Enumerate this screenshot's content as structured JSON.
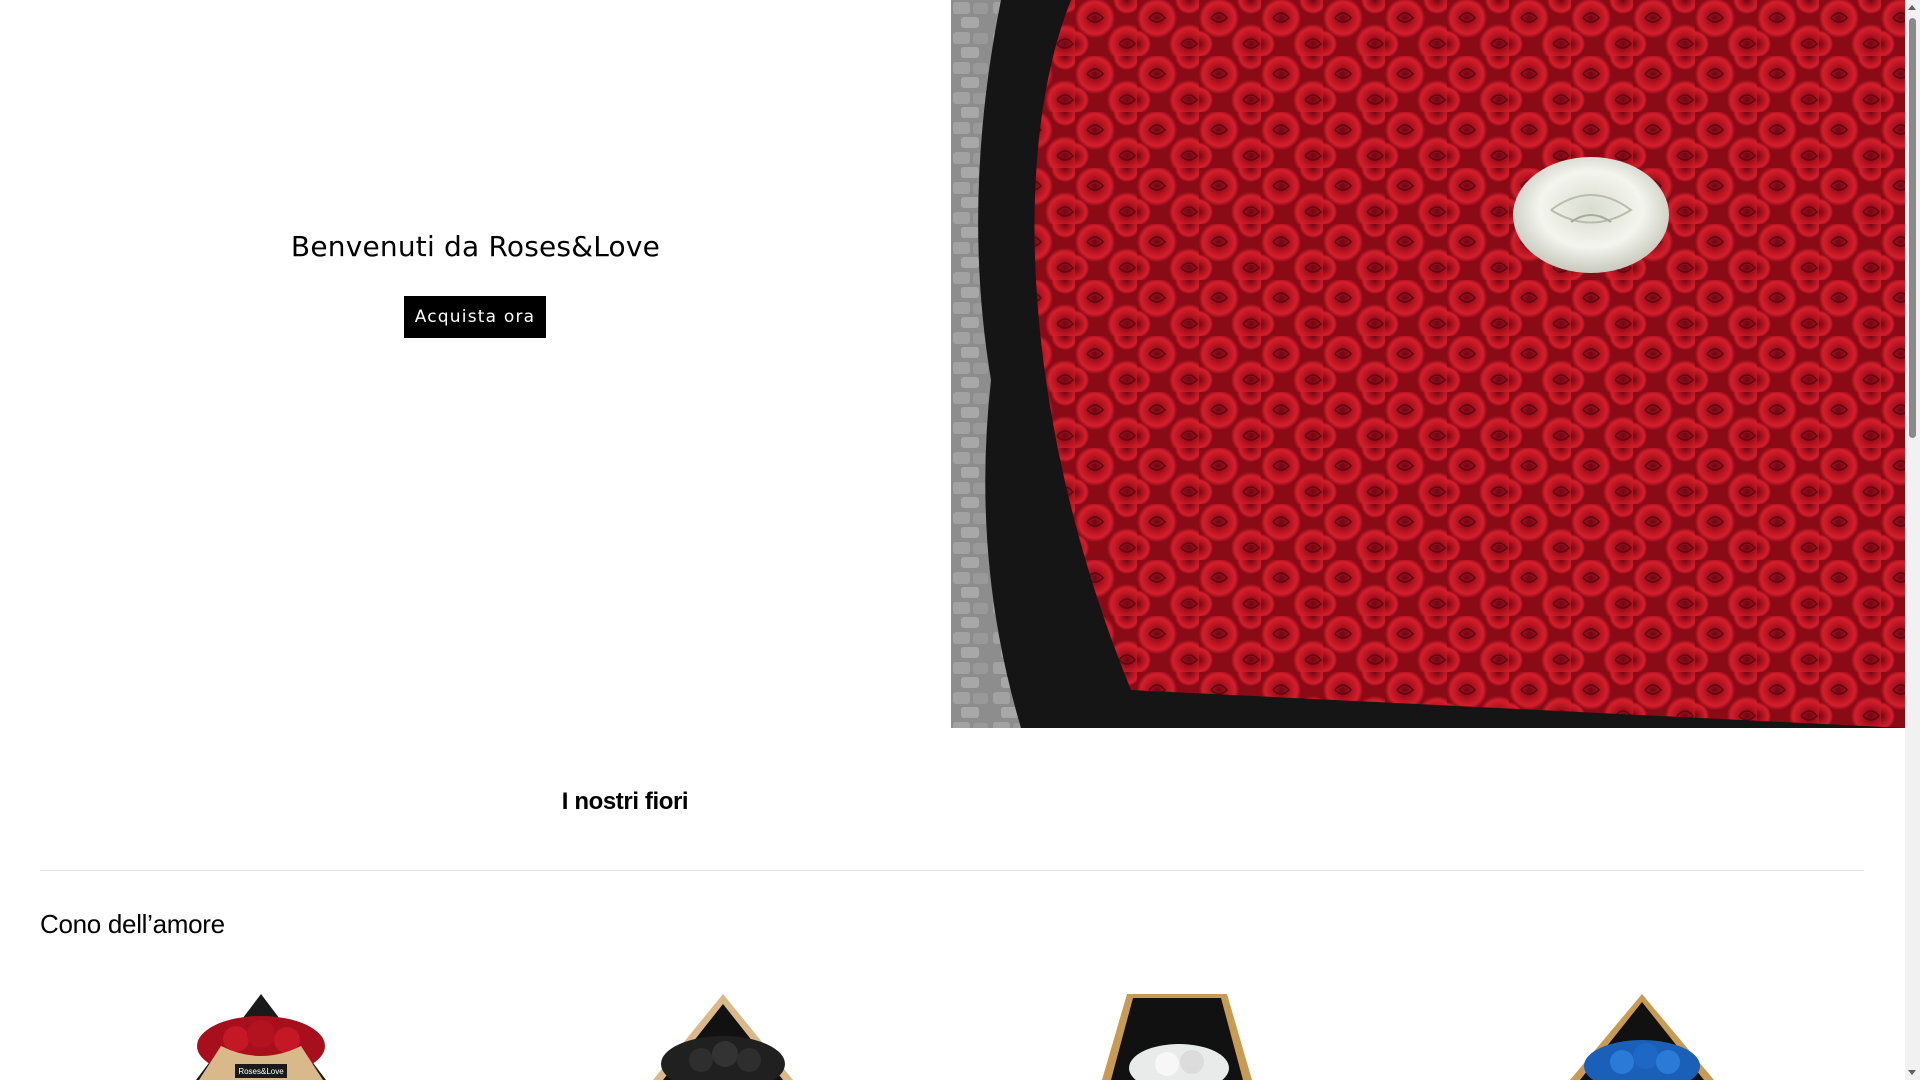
{
  "hero": {
    "title": "Benvenuti da Roses&Love",
    "cta_label": "Acquista ora",
    "image": "red-roses-bouquet-with-white-rose"
  },
  "section": {
    "title": "I nostri fiori"
  },
  "category": {
    "title": "Cono dell’amore"
  },
  "products": [
    {
      "image": "red-roses-cone-bouquet",
      "wrap_label": "Roses&Love"
    },
    {
      "image": "black-roses-cone-bouquet"
    },
    {
      "image": "white-roses-cone-bouquet"
    },
    {
      "image": "blue-roses-cone-bouquet"
    }
  ],
  "colors": {
    "rose_red": "#b0101f",
    "button_bg": "#000000",
    "button_text": "#ffffff",
    "kraft": "#d9b98a"
  }
}
